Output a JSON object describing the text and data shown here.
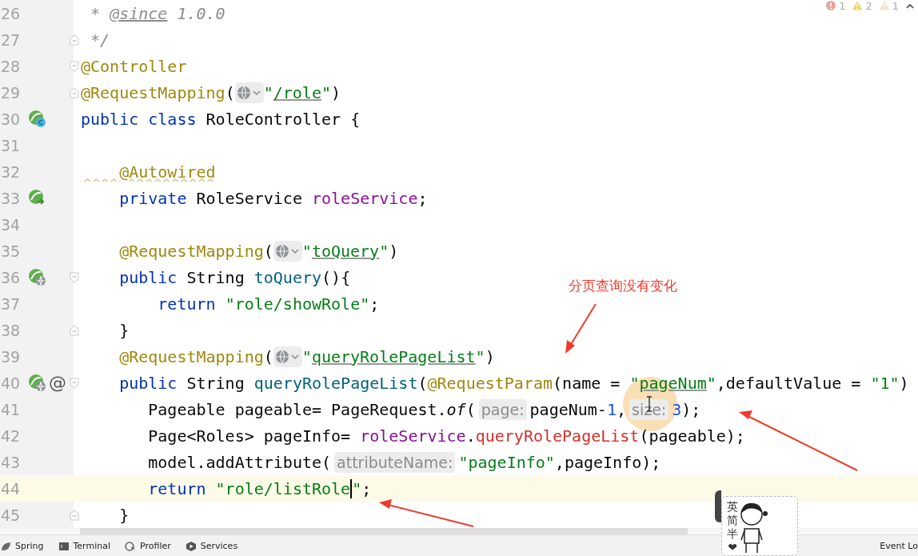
{
  "inspection": [
    {
      "kind": "error",
      "count": "1"
    },
    {
      "kind": "warning",
      "count": "2"
    },
    {
      "kind": "weak",
      "count": "1"
    }
  ],
  "editor": {
    "lines": [
      {
        "number": "26",
        "current": false,
        "tokens": [
          {
            "kind": "comment",
            "text": " * "
          },
          {
            "kind": "doctag",
            "text": "@since"
          },
          {
            "kind": "comment",
            "text": " 1.0.0"
          }
        ]
      },
      {
        "number": "27",
        "fold_end": true,
        "current": false,
        "tokens": [
          {
            "kind": "comment",
            "text": " */"
          }
        ]
      },
      {
        "number": "28",
        "fold_start": true,
        "current": false,
        "tokens": [
          {
            "kind": "annotation",
            "text": "@Controller"
          }
        ]
      },
      {
        "number": "29",
        "fold_end": true,
        "current": false,
        "tokens": [
          {
            "kind": "annotation",
            "text": "@RequestMapping"
          },
          {
            "kind": "plain",
            "text": "("
          },
          {
            "kind": "globe"
          },
          {
            "kind": "string",
            "text": "\""
          },
          {
            "kind": "link",
            "text": "/role"
          },
          {
            "kind": "string",
            "text": "\""
          },
          {
            "kind": "plain",
            "text": ")"
          }
        ]
      },
      {
        "number": "30",
        "gutter": [
          {
            "kind": "bean"
          }
        ],
        "current": false,
        "tokens": [
          {
            "kind": "keyword",
            "text": "public class "
          },
          {
            "kind": "plain",
            "text": "RoleController {"
          }
        ]
      },
      {
        "number": "31",
        "current": false
      },
      {
        "number": "32",
        "current": false,
        "tokens": [
          {
            "kind": "annotation",
            "text": "    @Autowired",
            "warning": true
          }
        ]
      },
      {
        "number": "33",
        "gutter": [
          {
            "kind": "inject"
          }
        ],
        "current": false,
        "tokens": [
          {
            "kind": "keyword",
            "text": "    private "
          },
          {
            "kind": "plain",
            "text": "RoleService "
          },
          {
            "kind": "field",
            "text": "roleService"
          },
          {
            "kind": "plain",
            "text": ";"
          }
        ]
      },
      {
        "number": "34",
        "current": false
      },
      {
        "number": "35",
        "current": false,
        "tokens": [
          {
            "kind": "annotation",
            "text": "    @RequestMapping"
          },
          {
            "kind": "plain",
            "text": "("
          },
          {
            "kind": "globe"
          },
          {
            "kind": "string",
            "text": "\""
          },
          {
            "kind": "link",
            "text": "toQuery"
          },
          {
            "kind": "string",
            "text": "\""
          },
          {
            "kind": "plain",
            "text": ")"
          }
        ]
      },
      {
        "number": "36",
        "gutter": [
          {
            "kind": "endpoint"
          }
        ],
        "fold_start": true,
        "current": false,
        "tokens": [
          {
            "kind": "keyword",
            "text": "    public "
          },
          {
            "kind": "plain",
            "text": "String "
          },
          {
            "kind": "decl",
            "text": "toQuery"
          },
          {
            "kind": "plain",
            "text": "(){"
          }
        ]
      },
      {
        "number": "37",
        "current": false,
        "tokens": [
          {
            "kind": "keyword",
            "text": "        return "
          },
          {
            "kind": "string",
            "text": "\"role/showRole\""
          },
          {
            "kind": "plain",
            "text": ";"
          }
        ]
      },
      {
        "number": "38",
        "fold_end": true,
        "current": false,
        "tokens": [
          {
            "kind": "plain",
            "text": "    }"
          }
        ]
      },
      {
        "number": "39",
        "current": false,
        "tokens": [
          {
            "kind": "annotation",
            "text": "    @RequestMapping"
          },
          {
            "kind": "plain",
            "text": "("
          },
          {
            "kind": "globe"
          },
          {
            "kind": "string",
            "text": "\""
          },
          {
            "kind": "link",
            "text": "queryRolePageList"
          },
          {
            "kind": "string",
            "text": "\""
          },
          {
            "kind": "plain",
            "text": ")"
          }
        ]
      },
      {
        "number": "40",
        "gutter": [
          {
            "kind": "endpoint"
          },
          {
            "kind": "text",
            "text": "@"
          }
        ],
        "fold_start": true,
        "current": false,
        "tokens": [
          {
            "kind": "keyword",
            "text": "    public "
          },
          {
            "kind": "plain",
            "text": "String "
          },
          {
            "kind": "decl",
            "text": "queryRolePageList"
          },
          {
            "kind": "plain",
            "text": "("
          },
          {
            "kind": "annotation",
            "text": "@RequestParam"
          },
          {
            "kind": "plain",
            "text": "(name = "
          },
          {
            "kind": "string",
            "text": "\""
          },
          {
            "kind": "link",
            "text": "pageNum"
          },
          {
            "kind": "string",
            "text": "\""
          },
          {
            "kind": "plain",
            "text": ",defaultValue = "
          },
          {
            "kind": "string",
            "text": "\"1\""
          },
          {
            "kind": "plain",
            "text": ")"
          }
        ]
      },
      {
        "number": "41",
        "current": false,
        "tokens": [
          {
            "kind": "plain",
            "text": "       Pageable pageable= PageRequest."
          },
          {
            "kind": "static",
            "text": "of"
          },
          {
            "kind": "plain",
            "text": "("
          },
          {
            "kind": "hint",
            "text": "page:"
          },
          {
            "kind": "plain",
            "text": "pageNum-"
          },
          {
            "kind": "number",
            "text": "1"
          },
          {
            "kind": "plain",
            "text": ","
          },
          {
            "kind": "hint",
            "text": "size:"
          },
          {
            "kind": "number",
            "text": "3"
          },
          {
            "kind": "plain",
            "text": ");"
          }
        ]
      },
      {
        "number": "42",
        "current": false,
        "tokens": [
          {
            "kind": "plain",
            "text": "       Page<Roles> pageInfo= "
          },
          {
            "kind": "field",
            "text": "roleService"
          },
          {
            "kind": "plain",
            "text": "."
          },
          {
            "kind": "call",
            "text": "queryRolePageList"
          },
          {
            "kind": "plain",
            "text": "(pageable);"
          }
        ]
      },
      {
        "number": "43",
        "current": false,
        "tokens": [
          {
            "kind": "plain",
            "text": "       model.addAttribute("
          },
          {
            "kind": "hint",
            "text": "attributeName:"
          },
          {
            "kind": "string",
            "text": "\"pageInfo\""
          },
          {
            "kind": "plain",
            "text": ",pageInfo);"
          }
        ]
      },
      {
        "number": "44",
        "current": true,
        "tokens": [
          {
            "kind": "keyword",
            "text": "       return "
          },
          {
            "kind": "string",
            "text": "\"role/listRole"
          },
          {
            "kind": "caret"
          },
          {
            "kind": "string",
            "text": "\""
          },
          {
            "kind": "plain",
            "text": ";"
          }
        ]
      },
      {
        "number": "45",
        "fold_end": true,
        "current": false,
        "tokens": [
          {
            "kind": "plain",
            "text": "    }"
          }
        ]
      }
    ]
  },
  "note": "分页查询没有变化",
  "tool_windows": [
    {
      "kind": "spring",
      "label": "Spring"
    },
    {
      "kind": "terminal",
      "label": "Terminal"
    },
    {
      "kind": "profiler",
      "label": "Profiler"
    },
    {
      "kind": "services",
      "label": "Services"
    },
    {
      "kind": "event",
      "label": "Event Lo"
    }
  ],
  "ime": {
    "items": [
      "英",
      "简",
      "半",
      "❤"
    ]
  }
}
